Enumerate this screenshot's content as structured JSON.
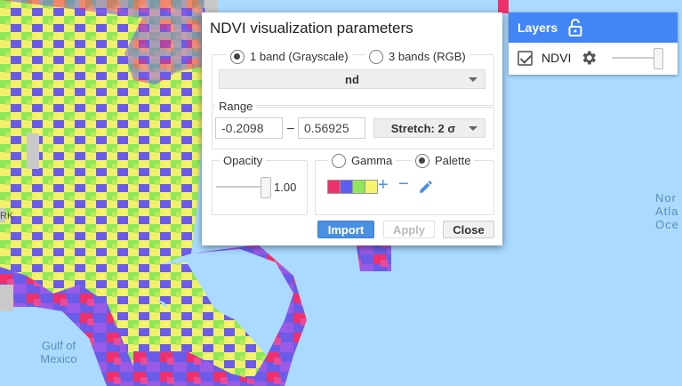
{
  "map": {
    "labels": {
      "gulf": "Gulf of\nMexico",
      "north_atlantic": "Nor\nAtla\nOce",
      "city_fragment": "RK"
    }
  },
  "layers_panel": {
    "title": "Layers",
    "layer": {
      "name": "NDVI",
      "checked": true
    }
  },
  "dialog": {
    "title": "NDVI visualization parameters",
    "band_mode": {
      "option_1": "1 band (Grayscale)",
      "option_2": "3 bands (RGB)",
      "selected": "1 band (Grayscale)"
    },
    "band_select": "nd",
    "range": {
      "legend": "Range",
      "min": "-0.2098",
      "max": "0.56925",
      "separator": "–",
      "stretch": "Stretch: 2 σ"
    },
    "opacity": {
      "legend": "Opacity",
      "value": "1.00",
      "level": 1.0
    },
    "color_mode": {
      "gamma": "Gamma",
      "palette": "Palette",
      "selected": "Palette"
    },
    "palette_colors": [
      "#f0306a",
      "#5d5df0",
      "#8ee85a",
      "#f5f56e"
    ],
    "buttons": {
      "import": "Import",
      "apply": "Apply",
      "close": "Close"
    }
  },
  "colors": {
    "accent": "#4285f4",
    "ocean": "#aadaff",
    "land_gray": "#c9c9c9"
  }
}
